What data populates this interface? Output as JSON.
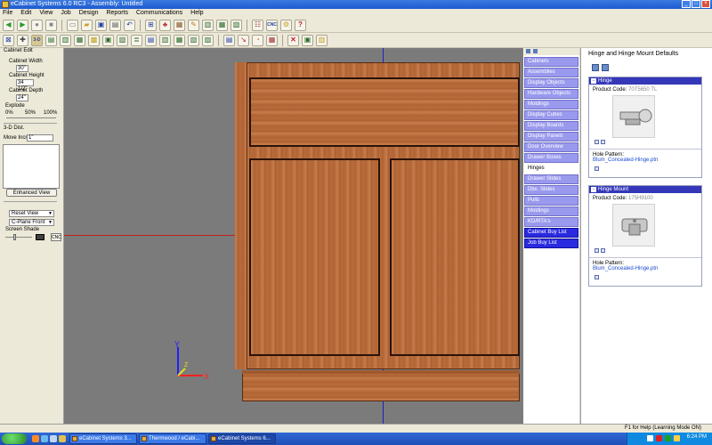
{
  "window": {
    "title": "eCabinet Systems 6.0 RC3 - Assembly: Untitled"
  },
  "menu": [
    "File",
    "Edit",
    "View",
    "Job",
    "Design",
    "Reports",
    "Communications",
    "Help"
  ],
  "toolbar1": {
    "icons": [
      "back-icon",
      "forward-icon",
      "record-icon",
      "stop-icon",
      "new-icon",
      "open-icon",
      "save-icon",
      "print-icon",
      "undo-icon",
      "assembly-icon",
      "paint-icon",
      "material-icon",
      "pencil-icon",
      "cabinet-icon",
      "stack-icon",
      "report-icon",
      "list-icon",
      "cnc-icon",
      "gear-icon",
      "help-icon"
    ],
    "cnc_label": "CNC"
  },
  "toolbar2": {
    "icons": [
      "select-icon",
      "edit-icon",
      "view-3d-icon",
      "view-front-icon",
      "view-top-icon",
      "view-side-icon",
      "dimension-icon",
      "grid-icon",
      "detail-icon",
      "layers-icon",
      "render-icon",
      "move-icon",
      "rotate-icon",
      "hide-icon",
      "reset-icon",
      "draw-icon",
      "line-icon",
      "measure-icon",
      "delete-icon",
      "bitmap-icon",
      "options-icon"
    ],
    "view_3d_label": "3-D"
  },
  "left_panel": {
    "title": "Cabinet Edit",
    "width_label": "Cabinet Width",
    "width_value": "30\"",
    "height_label": "Cabinet Height",
    "height_value": "34 1/2\"",
    "depth_label": "Cabinet Depth",
    "depth_value": "24\"",
    "explode_label": "Explode",
    "explode_scale": [
      "0%",
      "50%",
      "100%"
    ],
    "dist_label": "3-D Dist.",
    "move_label": "Move Incr.",
    "move_value": "1\"",
    "enhanced_view_label": "Enhanced View",
    "reset_view": "Reset View",
    "cplane": "C-Plane Front",
    "screen_shade_label": "Screen Shade",
    "cnc_label": "CNC"
  },
  "categories": [
    {
      "label": "Cabinets",
      "style": "light"
    },
    {
      "label": "Assemblies",
      "style": "light"
    },
    {
      "label": "Display Objects",
      "style": "light"
    },
    {
      "label": "Hardware Objects",
      "style": "light"
    },
    {
      "label": "Moldings",
      "style": "light"
    },
    {
      "label": "Display Cubes",
      "style": "light"
    },
    {
      "label": "Display Boards",
      "style": "light"
    },
    {
      "label": "Display Panels",
      "style": "light"
    },
    {
      "label": "Door Overview",
      "style": "light"
    },
    {
      "label": "Drawer Boxes",
      "style": "light"
    },
    {
      "label": "Hinges",
      "style": "selected"
    },
    {
      "label": "Drawer Slides",
      "style": "light"
    },
    {
      "label": "Dbx. Slides",
      "style": "light"
    },
    {
      "label": "Pulls",
      "style": "light"
    },
    {
      "label": "Moldings",
      "style": "light"
    },
    {
      "label": "KD/RTA's",
      "style": "light"
    },
    {
      "label": "Cabinet Buy List",
      "style": "dark"
    },
    {
      "label": "Job Buy List",
      "style": "dark"
    }
  ],
  "right_panel": {
    "title": "Hinge and Hinge Mount Defaults",
    "hinge": {
      "header": "Hinge",
      "product_code_label": "Product Code:",
      "product_code": "70T5650 TL",
      "hole_pattern_label": "Hole Pattern:",
      "hole_pattern": "Blum_Concealed-Hinge.ptn"
    },
    "mount": {
      "header": "Hinge Mount",
      "product_code_label": "Product Code:",
      "product_code": "175H9100",
      "hole_pattern_label": "Hole Pattern:",
      "hole_pattern": "Blum_Concealed-Hinge.ptn"
    }
  },
  "status": {
    "text": "F1 for Help (Learning Mode ON)"
  },
  "taskbar": {
    "start_label": "start",
    "tasks": [
      "eCabinet Systems 3...",
      "Thermwood / eCabi...",
      "eCabinet Systems 6..."
    ],
    "clock": "6:24 PM"
  },
  "triad": {
    "y_label": "Y",
    "x_label": "X",
    "z_label": "Z"
  },
  "colors": {
    "wood": "#b86b3a",
    "viewport": "#7b7b7b",
    "category_light": "#9999ee",
    "category_dark": "#2a2ae0",
    "accent": "#3438b8"
  }
}
